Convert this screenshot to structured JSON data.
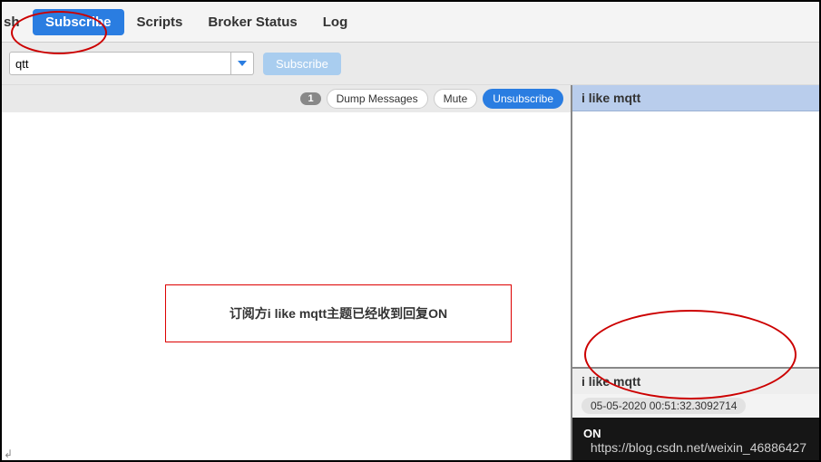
{
  "tabs": {
    "partial": "sh",
    "subscribe": "Subscribe",
    "scripts": "Scripts",
    "broker_status": "Broker Status",
    "log": "Log"
  },
  "subscribe_bar": {
    "topic_value": "qtt",
    "subscribe_btn": "Subscribe"
  },
  "topic_toolbar": {
    "count": "1",
    "dump": "Dump Messages",
    "mute": "Mute",
    "unsubscribe": "Unsubscribe"
  },
  "annotation": "订阅方i like mqtt主题已经收到回复ON",
  "right_panel": {
    "topic": "i like mqtt",
    "msg_topic": "i like mqtt",
    "timestamp": "05-05-2020  00:51:32.3092714",
    "payload": "ON"
  },
  "watermark": "https://blog.csdn.net/weixin_46886427",
  "return_marker": "↲"
}
